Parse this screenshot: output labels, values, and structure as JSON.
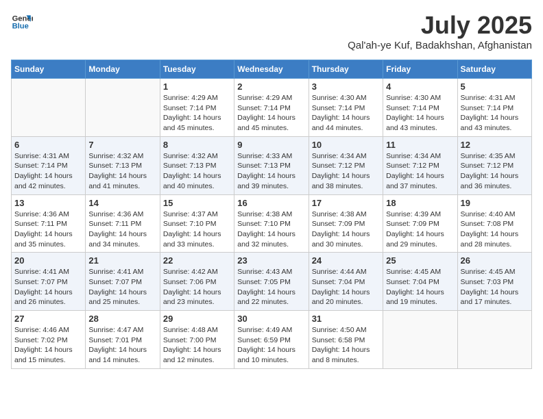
{
  "logo": {
    "line1": "General",
    "line2": "Blue"
  },
  "title": "July 2025",
  "subtitle": "Qal'ah-ye Kuf, Badakhshan, Afghanistan",
  "headers": [
    "Sunday",
    "Monday",
    "Tuesday",
    "Wednesday",
    "Thursday",
    "Friday",
    "Saturday"
  ],
  "weeks": [
    [
      {
        "day": "",
        "info": ""
      },
      {
        "day": "",
        "info": ""
      },
      {
        "day": "1",
        "info": "Sunrise: 4:29 AM\nSunset: 7:14 PM\nDaylight: 14 hours and 45 minutes."
      },
      {
        "day": "2",
        "info": "Sunrise: 4:29 AM\nSunset: 7:14 PM\nDaylight: 14 hours and 45 minutes."
      },
      {
        "day": "3",
        "info": "Sunrise: 4:30 AM\nSunset: 7:14 PM\nDaylight: 14 hours and 44 minutes."
      },
      {
        "day": "4",
        "info": "Sunrise: 4:30 AM\nSunset: 7:14 PM\nDaylight: 14 hours and 43 minutes."
      },
      {
        "day": "5",
        "info": "Sunrise: 4:31 AM\nSunset: 7:14 PM\nDaylight: 14 hours and 43 minutes."
      }
    ],
    [
      {
        "day": "6",
        "info": "Sunrise: 4:31 AM\nSunset: 7:14 PM\nDaylight: 14 hours and 42 minutes."
      },
      {
        "day": "7",
        "info": "Sunrise: 4:32 AM\nSunset: 7:13 PM\nDaylight: 14 hours and 41 minutes."
      },
      {
        "day": "8",
        "info": "Sunrise: 4:32 AM\nSunset: 7:13 PM\nDaylight: 14 hours and 40 minutes."
      },
      {
        "day": "9",
        "info": "Sunrise: 4:33 AM\nSunset: 7:13 PM\nDaylight: 14 hours and 39 minutes."
      },
      {
        "day": "10",
        "info": "Sunrise: 4:34 AM\nSunset: 7:12 PM\nDaylight: 14 hours and 38 minutes."
      },
      {
        "day": "11",
        "info": "Sunrise: 4:34 AM\nSunset: 7:12 PM\nDaylight: 14 hours and 37 minutes."
      },
      {
        "day": "12",
        "info": "Sunrise: 4:35 AM\nSunset: 7:12 PM\nDaylight: 14 hours and 36 minutes."
      }
    ],
    [
      {
        "day": "13",
        "info": "Sunrise: 4:36 AM\nSunset: 7:11 PM\nDaylight: 14 hours and 35 minutes."
      },
      {
        "day": "14",
        "info": "Sunrise: 4:36 AM\nSunset: 7:11 PM\nDaylight: 14 hours and 34 minutes."
      },
      {
        "day": "15",
        "info": "Sunrise: 4:37 AM\nSunset: 7:10 PM\nDaylight: 14 hours and 33 minutes."
      },
      {
        "day": "16",
        "info": "Sunrise: 4:38 AM\nSunset: 7:10 PM\nDaylight: 14 hours and 32 minutes."
      },
      {
        "day": "17",
        "info": "Sunrise: 4:38 AM\nSunset: 7:09 PM\nDaylight: 14 hours and 30 minutes."
      },
      {
        "day": "18",
        "info": "Sunrise: 4:39 AM\nSunset: 7:09 PM\nDaylight: 14 hours and 29 minutes."
      },
      {
        "day": "19",
        "info": "Sunrise: 4:40 AM\nSunset: 7:08 PM\nDaylight: 14 hours and 28 minutes."
      }
    ],
    [
      {
        "day": "20",
        "info": "Sunrise: 4:41 AM\nSunset: 7:07 PM\nDaylight: 14 hours and 26 minutes."
      },
      {
        "day": "21",
        "info": "Sunrise: 4:41 AM\nSunset: 7:07 PM\nDaylight: 14 hours and 25 minutes."
      },
      {
        "day": "22",
        "info": "Sunrise: 4:42 AM\nSunset: 7:06 PM\nDaylight: 14 hours and 23 minutes."
      },
      {
        "day": "23",
        "info": "Sunrise: 4:43 AM\nSunset: 7:05 PM\nDaylight: 14 hours and 22 minutes."
      },
      {
        "day": "24",
        "info": "Sunrise: 4:44 AM\nSunset: 7:04 PM\nDaylight: 14 hours and 20 minutes."
      },
      {
        "day": "25",
        "info": "Sunrise: 4:45 AM\nSunset: 7:04 PM\nDaylight: 14 hours and 19 minutes."
      },
      {
        "day": "26",
        "info": "Sunrise: 4:45 AM\nSunset: 7:03 PM\nDaylight: 14 hours and 17 minutes."
      }
    ],
    [
      {
        "day": "27",
        "info": "Sunrise: 4:46 AM\nSunset: 7:02 PM\nDaylight: 14 hours and 15 minutes."
      },
      {
        "day": "28",
        "info": "Sunrise: 4:47 AM\nSunset: 7:01 PM\nDaylight: 14 hours and 14 minutes."
      },
      {
        "day": "29",
        "info": "Sunrise: 4:48 AM\nSunset: 7:00 PM\nDaylight: 14 hours and 12 minutes."
      },
      {
        "day": "30",
        "info": "Sunrise: 4:49 AM\nSunset: 6:59 PM\nDaylight: 14 hours and 10 minutes."
      },
      {
        "day": "31",
        "info": "Sunrise: 4:50 AM\nSunset: 6:58 PM\nDaylight: 14 hours and 8 minutes."
      },
      {
        "day": "",
        "info": ""
      },
      {
        "day": "",
        "info": ""
      }
    ]
  ]
}
